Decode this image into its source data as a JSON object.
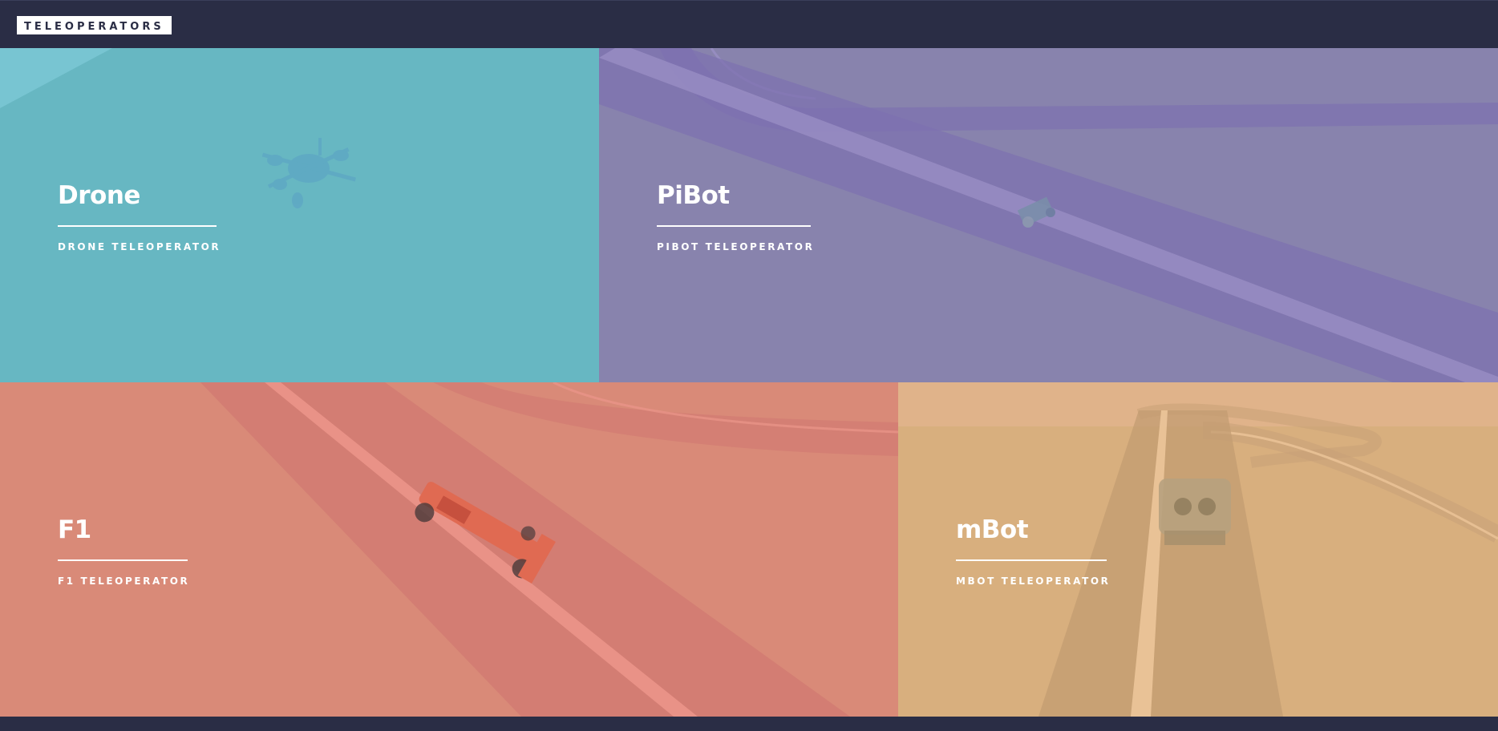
{
  "header": {
    "logo_text": "TELEOPERATORS"
  },
  "tiles": [
    {
      "title": "Drone",
      "subtitle": "DRONE TELEOPERATOR",
      "color": "#67b7c2"
    },
    {
      "title": "PiBot",
      "subtitle": "PIBOT TELEOPERATOR",
      "color": "#8883ad"
    },
    {
      "title": "F1",
      "subtitle": "F1 TELEOPERATOR",
      "color": "#d98a78"
    },
    {
      "title": "mBot",
      "subtitle": "MBOT TELEOPERATOR",
      "color": "#d8af7e"
    }
  ]
}
